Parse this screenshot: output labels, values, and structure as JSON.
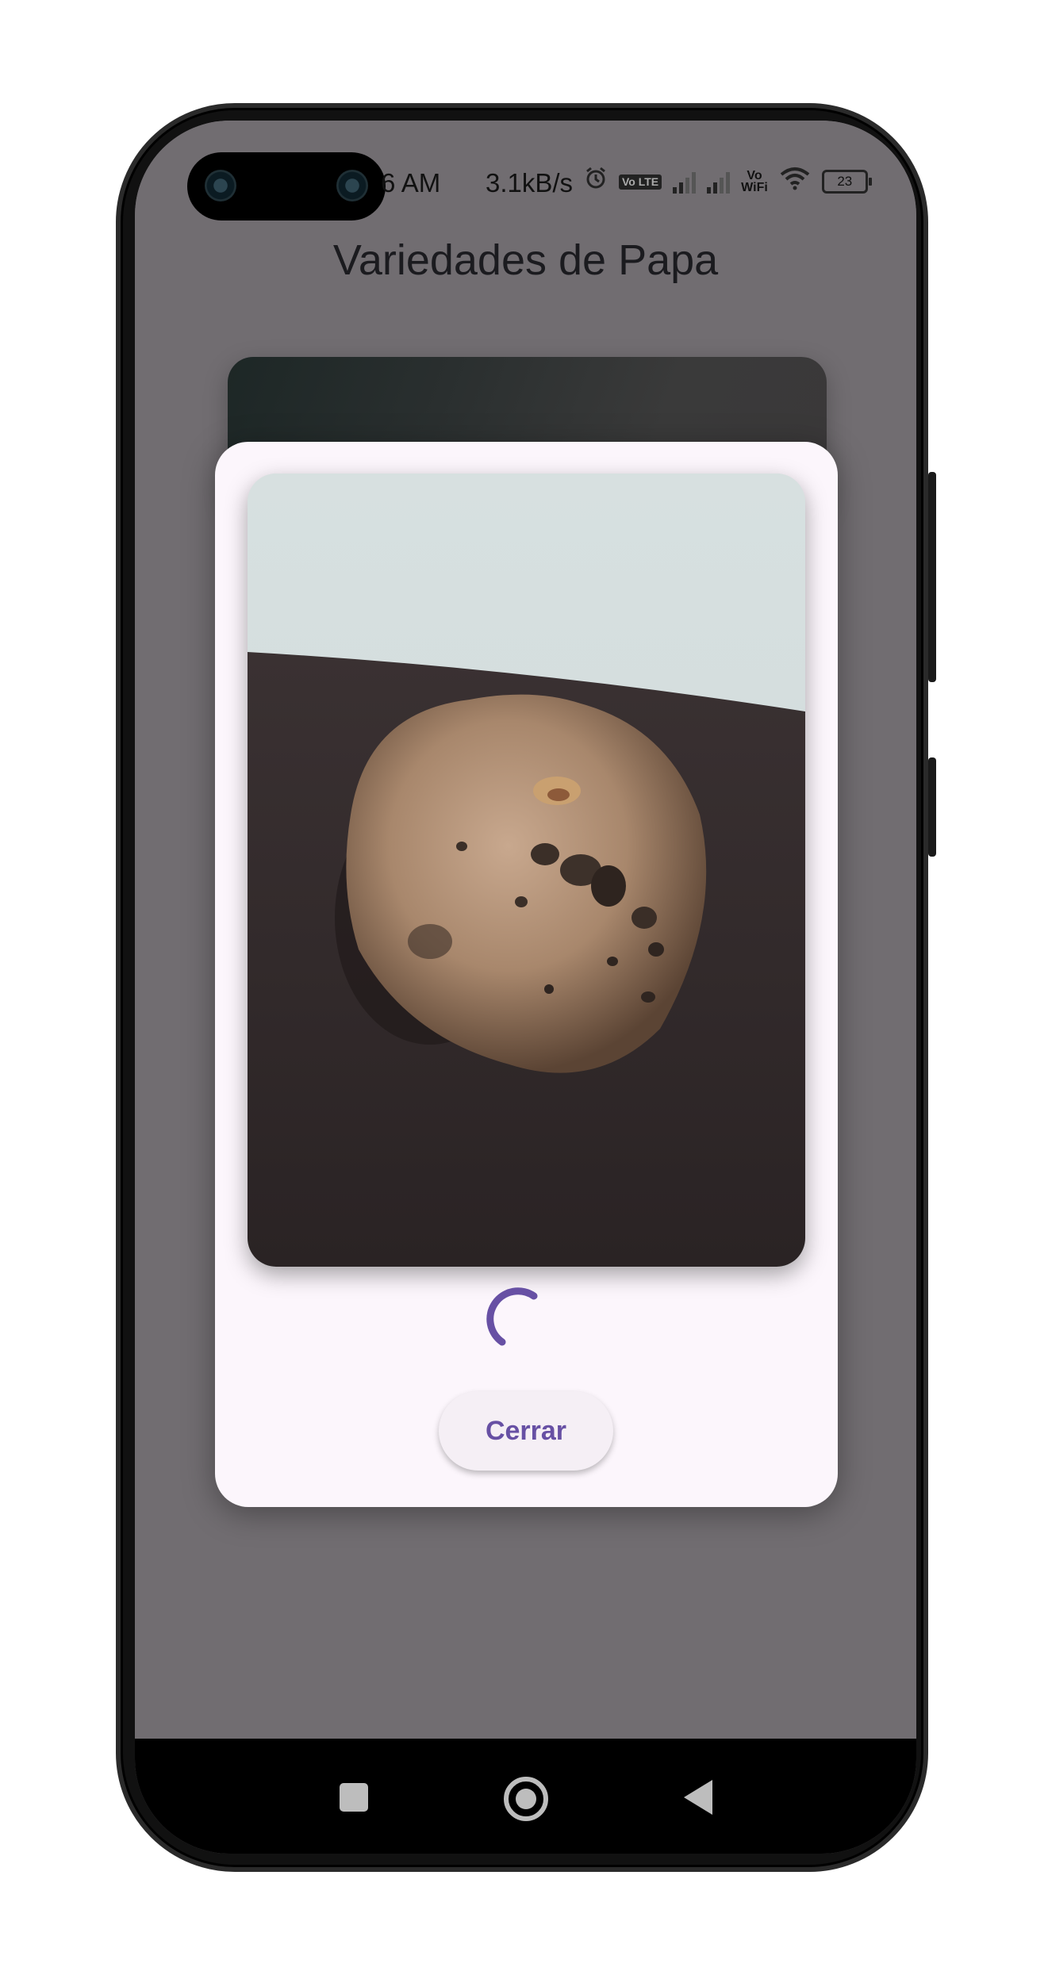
{
  "status_bar": {
    "time": "6 AM",
    "net_speed": "3.1kB/s",
    "battery": "23",
    "volte_label": "Vo LTE",
    "vowifi_top": "Vo",
    "vowifi_bottom": "WiFi",
    "icons": [
      "alarm-icon",
      "volte-icon",
      "signal-icon",
      "signal-icon",
      "vowifi-icon",
      "wifi-icon",
      "battery-icon"
    ]
  },
  "app": {
    "title": "Variedades de Papa"
  },
  "dialog": {
    "image_subject": "potato-photo",
    "close_label": "Cerrar",
    "accent_color": "#6750a4",
    "loading": true
  },
  "navbar": {
    "icons": [
      "recents-square-icon",
      "home-circle-icon",
      "back-triangle-icon"
    ]
  }
}
